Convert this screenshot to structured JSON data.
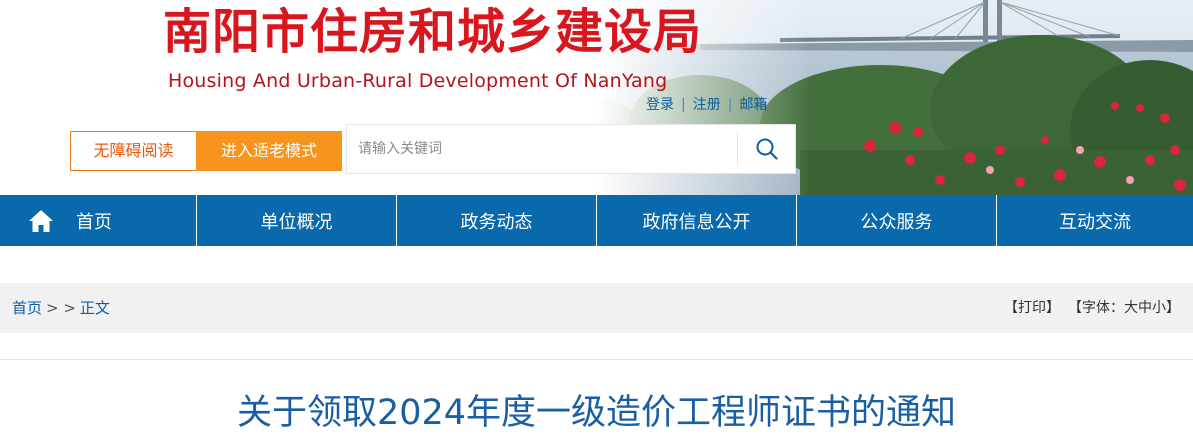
{
  "header": {
    "title": "南阳市住房和城乡建设局",
    "subtitle": "Housing And Urban-Rural Development Of NanYang",
    "user_links": [
      "登录",
      "注册",
      "邮箱"
    ],
    "accessibility_label": "无障碍阅读",
    "elder_mode_label": "进入适老模式",
    "search": {
      "placeholder": "请输入关键词",
      "value": ""
    }
  },
  "nav": {
    "items": [
      "首页",
      "单位概况",
      "政务动态",
      "政府信息公开",
      "公众服务",
      "互动交流"
    ]
  },
  "breadcrumb": {
    "home": "首页",
    "separator": "> >",
    "current": "正文"
  },
  "tools": {
    "print": "【打印】",
    "font_prefix": "【字体：",
    "large": "大",
    "medium": "中",
    "small": "小",
    "font_suffix": "】"
  },
  "article": {
    "title": "关于领取2024年度一级造价工程师证书的通知"
  },
  "colors": {
    "title_red": "#d9161d",
    "nav_blue": "#0a68ad",
    "link_blue": "#0b5fa5",
    "elder_orange": "#f6941d",
    "article_blue": "#1a5fa3"
  }
}
